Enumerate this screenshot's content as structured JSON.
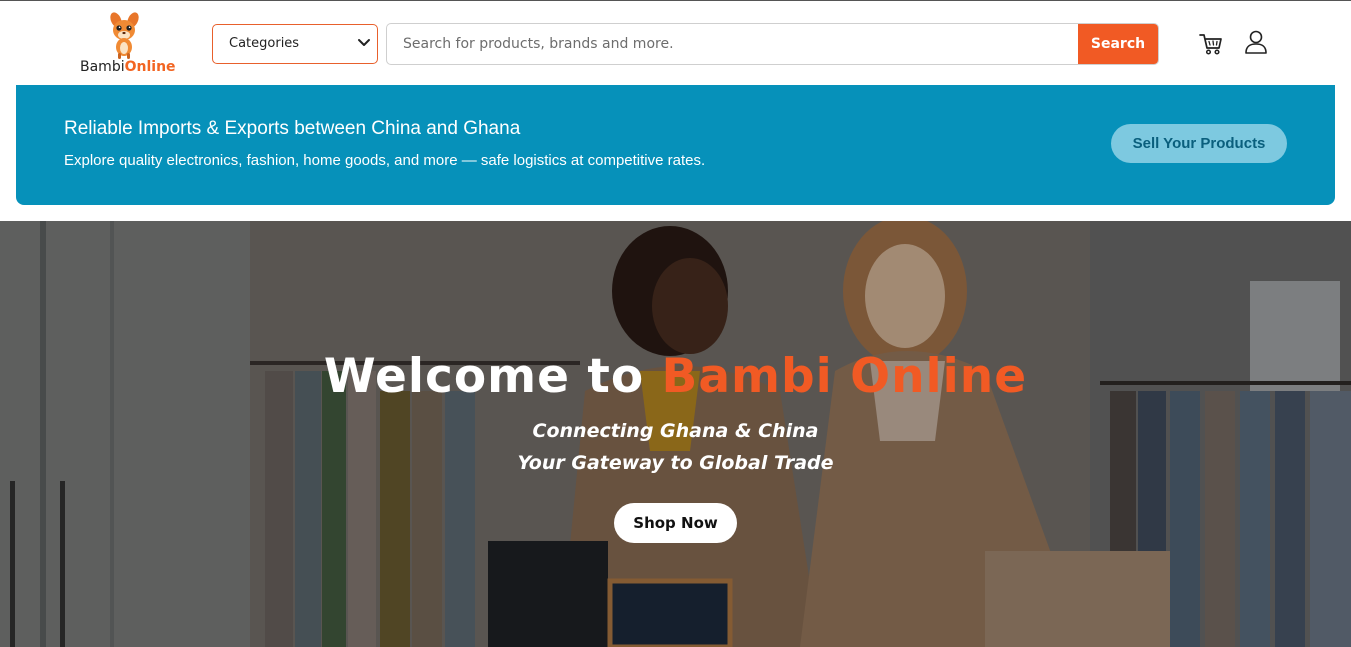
{
  "brand": {
    "name_part1": "Bambi",
    "name_part2": "Online",
    "accent_color": "#f15a24"
  },
  "header": {
    "categories_select": {
      "selected": "Categories"
    },
    "search": {
      "placeholder": "Search for products, brands and more.",
      "value": "",
      "button_label": "Search"
    },
    "icons": [
      "cart-icon",
      "user-icon",
      "chevron-down-icon"
    ]
  },
  "promo": {
    "title": "Reliable Imports & Exports between China and Ghana",
    "subtitle": "Explore quality electronics, fashion, home goods, and more — safe logistics at competitive rates.",
    "button_label": "Sell Your Products",
    "background_color": "#0691ba"
  },
  "hero": {
    "title_prefix": "Welcome to ",
    "title_brand": "Bambi Online",
    "line1": "Connecting Ghana & China",
    "line2": "Your Gateway to Global Trade",
    "button_label": "Shop Now"
  }
}
